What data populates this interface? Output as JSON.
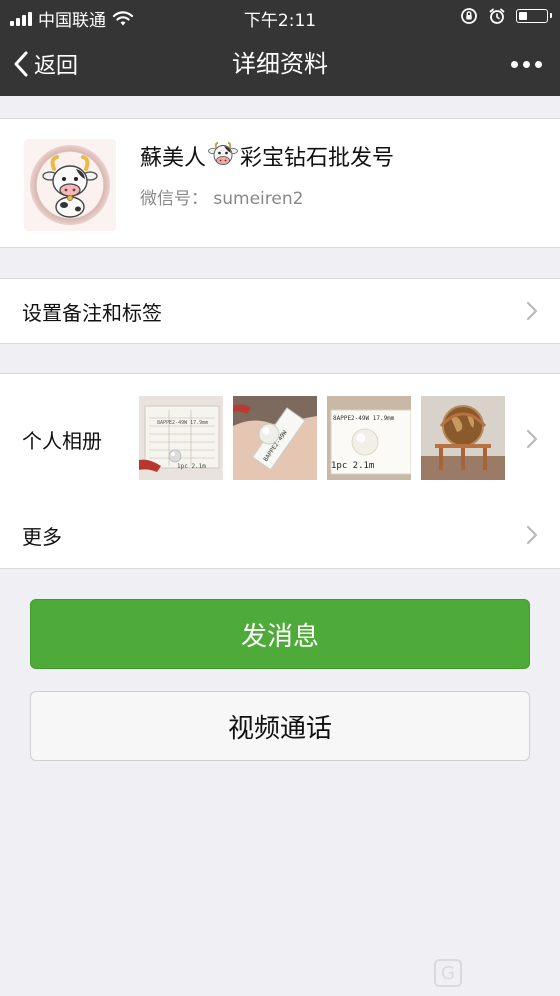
{
  "status_bar": {
    "carrier": "中国联通",
    "time": "下午2:11",
    "battery_level": 0.3
  },
  "nav": {
    "back_label": "返回",
    "title": "详细资料"
  },
  "profile": {
    "name_prefix": "蘇美人",
    "name_suffix": "彩宝钻石批发号",
    "name_emoji": "cow-face",
    "wechat_id_label": "微信号：",
    "wechat_id_value": "sumeiren2"
  },
  "rows": {
    "remark_label": "设置备注和标签",
    "album_label": "个人相册",
    "album_photo_count": 4,
    "more_label": "更多"
  },
  "album_thumbs": {
    "t1_tag": "8APPE2-49W 17.9mm",
    "t1_qty": "1pc 2.1m",
    "t3_tag": "8APPE2-49W 17.9mm",
    "t3_qty": "1pc 2.1m"
  },
  "buttons": {
    "message": "发消息",
    "video_call": "视频通话"
  },
  "colors": {
    "nav_bg": "#353535",
    "primary_green": "#4fab39",
    "page_bg": "#efeff4"
  }
}
